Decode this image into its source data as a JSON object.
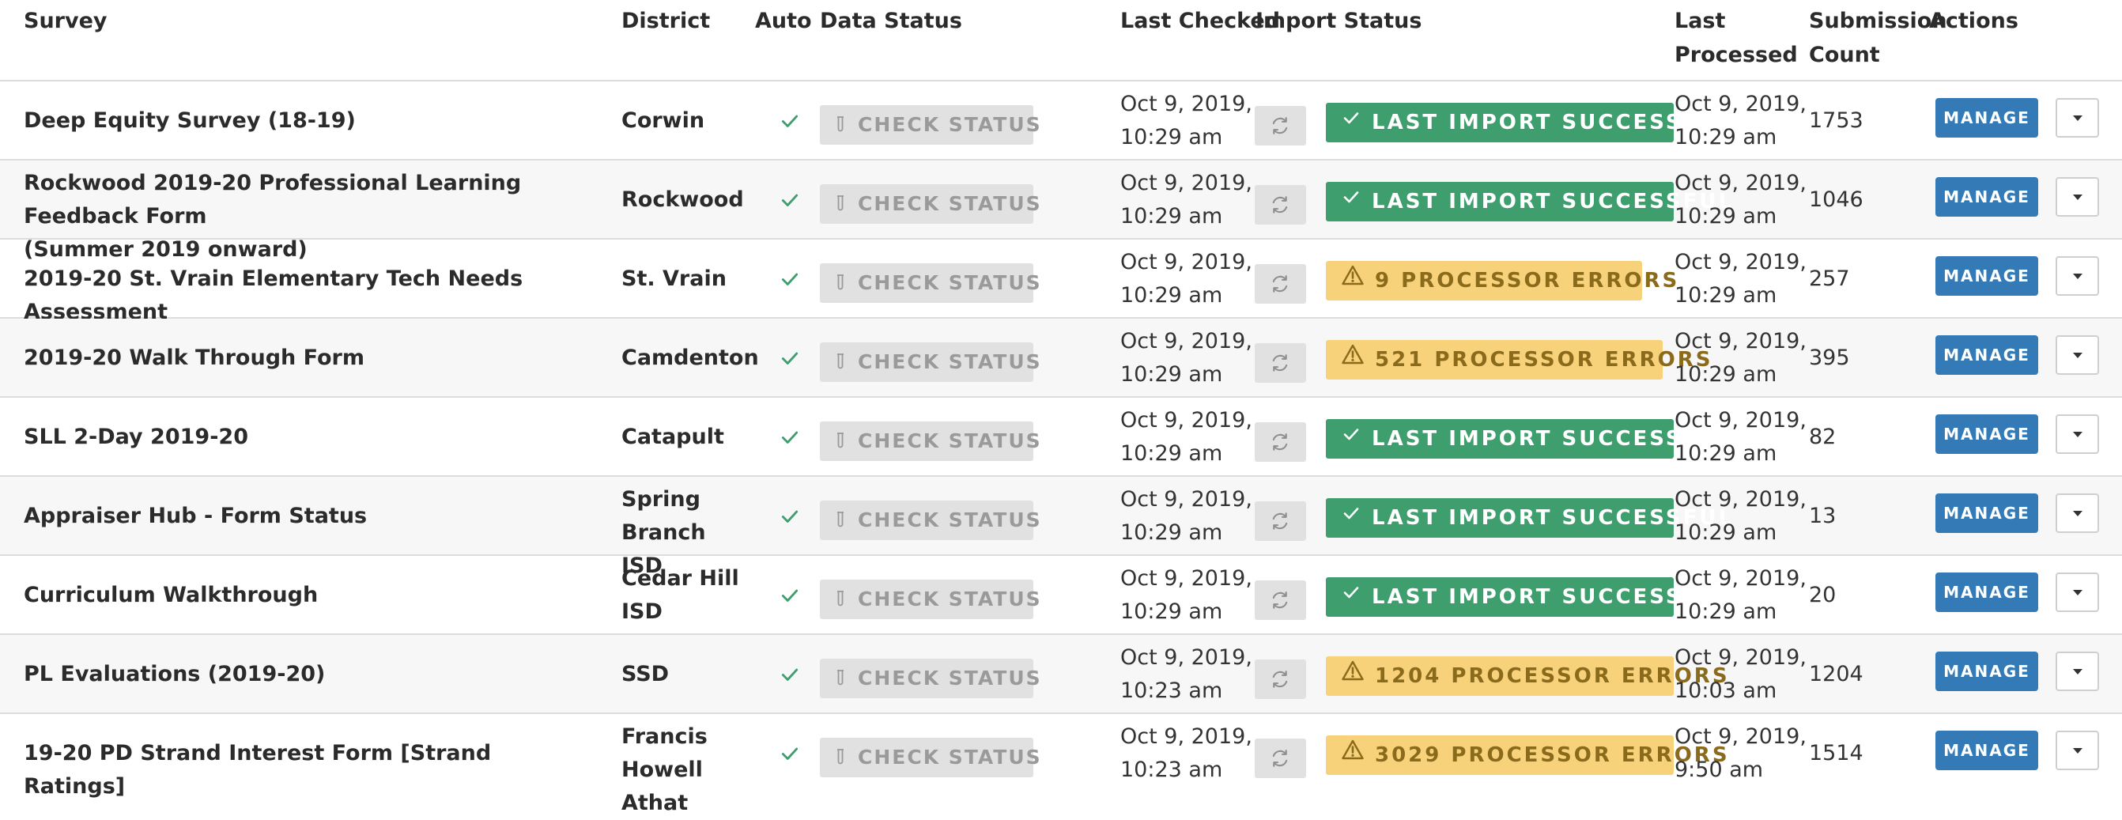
{
  "headers": {
    "survey": "Survey",
    "district": "District",
    "auto": "Auto",
    "data_status": "Data Status",
    "last_checked": "Last Checked",
    "import_status": "Import Status",
    "last_processed_1": "Last",
    "last_processed_2": "Processed",
    "submission_count_1": "Submission",
    "submission_count_2": "Count",
    "actions": "Actions"
  },
  "check_status_label": "CHECK STATUS",
  "manage_label": "MANAGE",
  "colors": {
    "success": "#3e9e6e",
    "warning": "#f7d27a",
    "primary": "#337ab7",
    "check": "#3e9e6e"
  },
  "icons": {
    "auto": "checkmark-icon",
    "refresh": "refresh-icon",
    "success": "checkmark-icon",
    "error": "warning-triangle-icon",
    "dropdown": "caret-down-icon"
  },
  "rows": [
    {
      "survey_lines": [
        "Deep Equity Survey (18-19)"
      ],
      "district_lines": [
        "Corwin"
      ],
      "last_checked_lines": [
        "Oct 9, 2019,",
        "10:29 am"
      ],
      "status_type": "success",
      "status_text": "LAST IMPORT SUCCESSFUL",
      "last_processed_lines": [
        "Oct 9, 2019,",
        "10:29 am"
      ],
      "count": "1753"
    },
    {
      "survey_lines": [
        "Rockwood 2019-20 Professional Learning Feedback Form",
        "(Summer 2019 onward)"
      ],
      "district_lines": [
        "Rockwood"
      ],
      "last_checked_lines": [
        "Oct 9, 2019,",
        "10:29 am"
      ],
      "status_type": "success",
      "status_text": "LAST IMPORT SUCCESSFUL",
      "last_processed_lines": [
        "Oct 9, 2019,",
        "10:29 am"
      ],
      "count": "1046"
    },
    {
      "survey_lines": [
        "2019-20 St. Vrain Elementary Tech Needs Assessment"
      ],
      "district_lines": [
        "St. Vrain"
      ],
      "last_checked_lines": [
        "Oct 9, 2019,",
        "10:29 am"
      ],
      "status_type": "error",
      "status_text": "9 PROCESSOR ERRORS",
      "last_processed_lines": [
        "Oct 9, 2019,",
        "10:29 am"
      ],
      "count": "257"
    },
    {
      "survey_lines": [
        "2019-20 Walk Through Form"
      ],
      "district_lines": [
        "Camdenton"
      ],
      "last_checked_lines": [
        "Oct 9, 2019,",
        "10:29 am"
      ],
      "status_type": "error",
      "status_text": "521 PROCESSOR ERRORS",
      "last_processed_lines": [
        "Oct 9, 2019,",
        "10:29 am"
      ],
      "count": "395"
    },
    {
      "survey_lines": [
        "SLL 2-Day 2019-20"
      ],
      "district_lines": [
        "Catapult"
      ],
      "last_checked_lines": [
        "Oct 9, 2019,",
        "10:29 am"
      ],
      "status_type": "success",
      "status_text": "LAST IMPORT SUCCESSFUL",
      "last_processed_lines": [
        "Oct 9, 2019,",
        "10:29 am"
      ],
      "count": "82"
    },
    {
      "survey_lines": [
        "Appraiser Hub - Form Status"
      ],
      "district_lines": [
        "Spring",
        "Branch ISD"
      ],
      "last_checked_lines": [
        "Oct 9, 2019,",
        "10:29 am"
      ],
      "status_type": "success",
      "status_text": "LAST IMPORT SUCCESSFUL",
      "last_processed_lines": [
        "Oct 9, 2019,",
        "10:29 am"
      ],
      "count": "13"
    },
    {
      "survey_lines": [
        "Curriculum Walkthrough"
      ],
      "district_lines": [
        "Cedar Hill",
        "ISD"
      ],
      "last_checked_lines": [
        "Oct 9, 2019,",
        "10:29 am"
      ],
      "status_type": "success",
      "status_text": "LAST IMPORT SUCCESSFUL",
      "last_processed_lines": [
        "Oct 9, 2019,",
        "10:29 am"
      ],
      "count": "20"
    },
    {
      "survey_lines": [
        "PL Evaluations (2019-20)"
      ],
      "district_lines": [
        "SSD"
      ],
      "last_checked_lines": [
        "Oct 9, 2019,",
        "10:23 am"
      ],
      "status_type": "error",
      "status_text": "1204 PROCESSOR ERRORS",
      "last_processed_lines": [
        "Oct 9, 2019,",
        "10:03 am"
      ],
      "count": "1204"
    },
    {
      "survey_lines": [
        "19-20 PD Strand Interest Form [Strand Ratings]"
      ],
      "district_lines": [
        "Francis",
        "Howell",
        "Athat"
      ],
      "last_checked_lines": [
        "Oct 9, 2019,",
        "10:23 am"
      ],
      "status_type": "error",
      "status_text": "3029 PROCESSOR ERRORS",
      "last_processed_lines": [
        "Oct 9, 2019,",
        "9:50 am"
      ],
      "count": "1514"
    }
  ]
}
